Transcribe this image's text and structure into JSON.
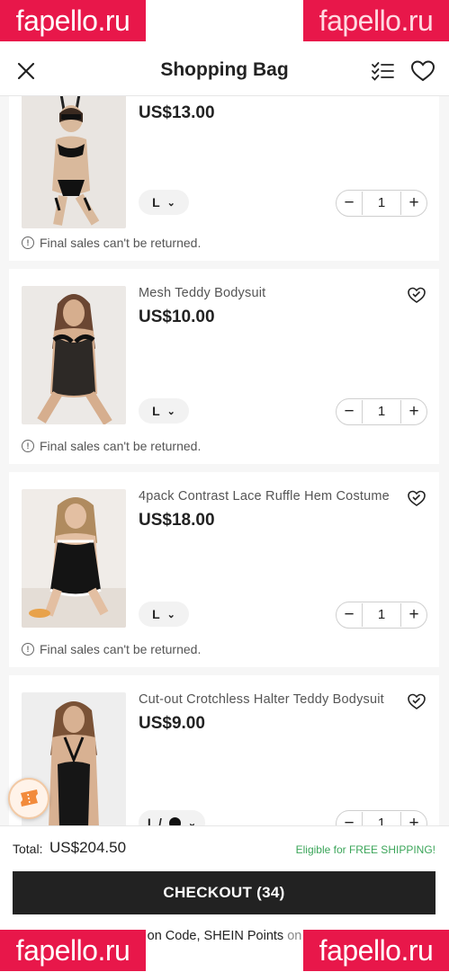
{
  "header": {
    "title": "Shopping Bag"
  },
  "watermark": "fapello.ru",
  "items": [
    {
      "name": "",
      "price": "US$13.00",
      "size": "L",
      "color_swatch": "",
      "qty": "1",
      "notice": "Final sales can't be returned."
    },
    {
      "name": "Mesh Teddy Bodysuit",
      "price": "US$10.00",
      "size": "L",
      "color_swatch": "",
      "qty": "1",
      "notice": "Final sales can't be returned."
    },
    {
      "name": "4pack Contrast Lace Ruffle Hem Costume",
      "price": "US$18.00",
      "size": "L",
      "color_swatch": "",
      "qty": "1",
      "notice": "Final sales can't be returned."
    },
    {
      "name": "Cut-out Crotchless Halter Teddy Bodysuit",
      "price": "US$9.00",
      "size": "L /",
      "color_swatch": "#111111",
      "qty": "1",
      "notice": ""
    }
  ],
  "stepper": {
    "minus": "−",
    "plus": "+"
  },
  "footer": {
    "total_label": "Total:",
    "total_value": "US$204.50",
    "shipping": "Eligible for FREE SHIPPING!",
    "checkout_label": "CHECKOUT (34)",
    "promo_text": "on Code, SHEIN Points",
    "promo_suffix": "on"
  },
  "colors": {
    "accent": "#222222",
    "free_shipping": "#3ba559",
    "watermark": "#e8174a"
  }
}
